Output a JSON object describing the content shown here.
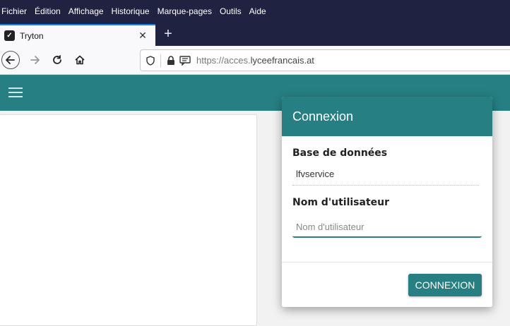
{
  "menu": {
    "items": [
      "Fichier",
      "Édition",
      "Affichage",
      "Historique",
      "Marque-pages",
      "Outils",
      "Aide"
    ]
  },
  "tab": {
    "title": "Tryton",
    "close_glyph": "✕",
    "new_glyph": "+"
  },
  "address": {
    "url_prefix": "https://acces.",
    "url_domain": "lyceefrancais.at"
  },
  "colors": {
    "accent": "#267f82",
    "titlebar": "#1f2341"
  },
  "dialog": {
    "title": "Connexion",
    "database_label": "Base de données",
    "database_value": "lfvservice",
    "username_label": "Nom d'utilisateur",
    "username_placeholder": "Nom d'utilisateur",
    "username_value": "",
    "submit_label": "CONNEXION"
  }
}
